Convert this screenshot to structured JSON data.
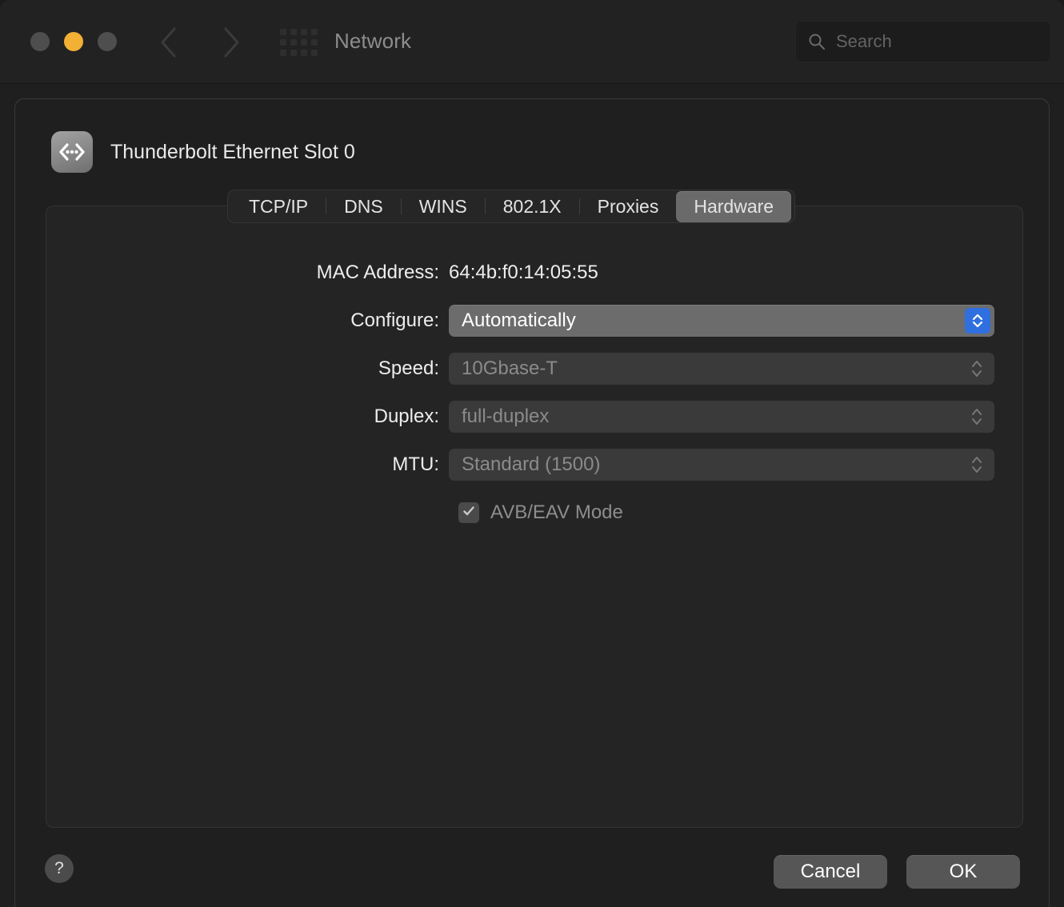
{
  "window": {
    "title": "Network",
    "traffic_lights": [
      "close",
      "minimize",
      "zoom"
    ]
  },
  "toolbar": {
    "back_icon": "chevron-left-icon",
    "forward_icon": "chevron-right-icon",
    "grid_icon": "show-all-grid-icon",
    "search": {
      "placeholder": "Search",
      "value": "",
      "icon": "search-icon"
    }
  },
  "sheet": {
    "interface": {
      "icon": "ethernet-icon",
      "name": "Thunderbolt Ethernet Slot 0"
    },
    "tabs": [
      {
        "label": "TCP/IP",
        "selected": false
      },
      {
        "label": "DNS",
        "selected": false
      },
      {
        "label": "WINS",
        "selected": false
      },
      {
        "label": "802.1X",
        "selected": false
      },
      {
        "label": "Proxies",
        "selected": false
      },
      {
        "label": "Hardware",
        "selected": true
      }
    ],
    "form": {
      "mac_address": {
        "label": "MAC Address:",
        "value": "64:4b:f0:14:05:55"
      },
      "configure": {
        "label": "Configure:",
        "value": "Automatically",
        "enabled": true,
        "stepper_icon": "chevron-up-down-icon"
      },
      "speed": {
        "label": "Speed:",
        "value": "10Gbase-T",
        "enabled": false,
        "stepper_icon": "chevron-up-down-icon"
      },
      "duplex": {
        "label": "Duplex:",
        "value": "full-duplex",
        "enabled": false,
        "stepper_icon": "chevron-up-down-icon"
      },
      "mtu": {
        "label": "MTU:",
        "value": "Standard  (1500)",
        "enabled": false,
        "stepper_icon": "chevron-up-down-icon"
      },
      "avb_mode": {
        "label": "AVB/EAV Mode",
        "checked": true,
        "enabled": false,
        "check_icon": "checkmark-icon"
      }
    },
    "footer": {
      "help_label": "?",
      "cancel_label": "Cancel",
      "ok_label": "OK"
    }
  },
  "colors": {
    "accent_blue": "#2f6fe0",
    "amber": "#f2b034",
    "window_bg": "#1f1f1f",
    "panel_bg": "#242424"
  }
}
